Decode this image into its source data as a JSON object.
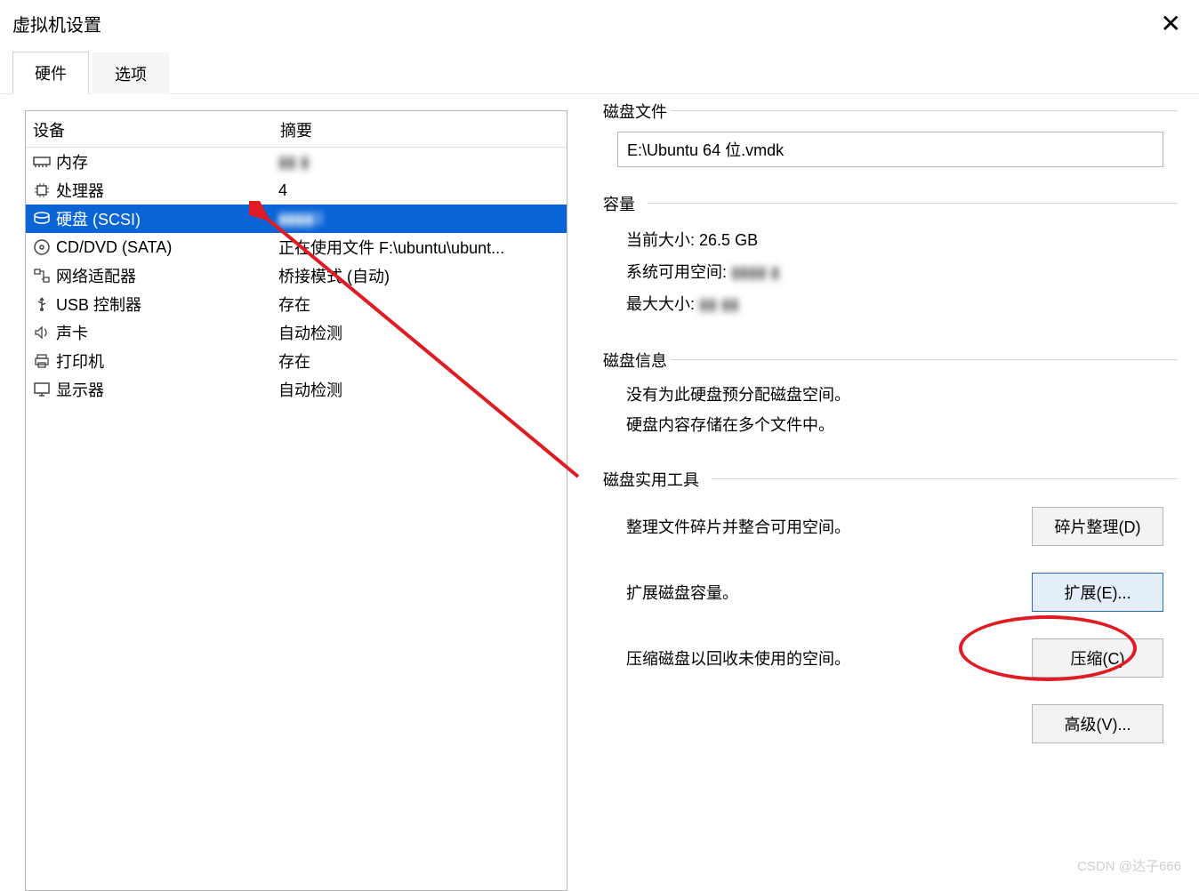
{
  "window": {
    "title": "虚拟机设置",
    "close": "✕"
  },
  "tabs": {
    "hardware": "硬件",
    "options": "选项"
  },
  "table": {
    "header_device": "设备",
    "header_summary": "摘要",
    "rows": {
      "memory": {
        "name": "内存",
        "summary": "▮▮ ▮"
      },
      "cpu": {
        "name": "处理器",
        "summary": "4"
      },
      "disk": {
        "name": "硬盘 (SCSI)",
        "summary": "▮▮▮▮3"
      },
      "cddvd": {
        "name": "CD/DVD (SATA)",
        "summary": "正在使用文件 F:\\ubuntu\\ubunt..."
      },
      "net": {
        "name": "网络适配器",
        "summary": "桥接模式 (自动)"
      },
      "usb": {
        "name": "USB 控制器",
        "summary": "存在"
      },
      "sound": {
        "name": "声卡",
        "summary": "自动检测"
      },
      "printer": {
        "name": "打印机",
        "summary": "存在"
      },
      "display": {
        "name": "显示器",
        "summary": "自动检测"
      }
    }
  },
  "diskfile": {
    "group_label": "磁盘文件",
    "path": "E:\\Ubuntu 64 位.vmdk"
  },
  "capacity": {
    "group_label": "容量",
    "current_label": "当前大小:",
    "current_value": "26.5 GB",
    "free_label": "系统可用空间:",
    "free_value": "▮▮▮▮ ▮",
    "max_label": "最大大小:",
    "max_value": "▮▮ ▮▮"
  },
  "diskinfo": {
    "group_label": "磁盘信息",
    "line1": "没有为此硬盘预分配磁盘空间。",
    "line2": "硬盘内容存储在多个文件中。"
  },
  "tools": {
    "group_label": "磁盘实用工具",
    "defrag_desc": "整理文件碎片并整合可用空间。",
    "defrag_btn": "碎片整理(D)",
    "expand_desc": "扩展磁盘容量。",
    "expand_btn": "扩展(E)...",
    "compact_desc": "压缩磁盘以回收未使用的空间。",
    "compact_btn": "压缩(C)",
    "advanced_btn": "高级(V)..."
  },
  "watermark": "CSDN @达子666"
}
